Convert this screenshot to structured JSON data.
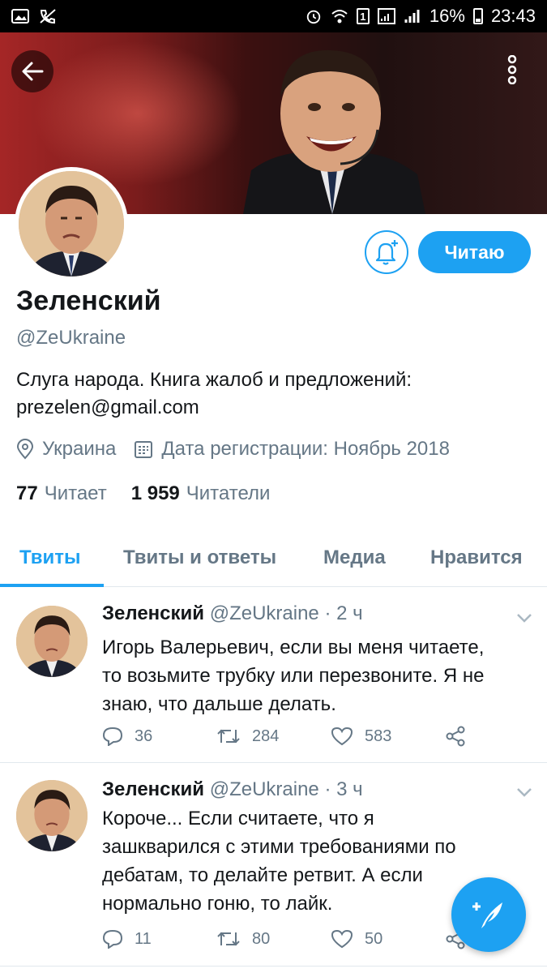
{
  "status_bar": {
    "sim_label": "1",
    "battery_percent": "16%",
    "time": "23:43"
  },
  "profile": {
    "name": "Зеленский",
    "handle": "@ZeUkraine",
    "bio_line1": "Слуга народа. Книга жалоб и предложений:",
    "bio_line2": "prezelen@gmail.com",
    "location": "Украина",
    "joined": "Дата регистрации: Ноябрь 2018",
    "following_count": "77",
    "following_label": "Читает",
    "followers_count": "1 959",
    "followers_label": "Читатели",
    "follow_button": "Читаю"
  },
  "tabs": [
    {
      "label": "Твиты",
      "active": true
    },
    {
      "label": "Твиты и ответы",
      "active": false
    },
    {
      "label": "Медиа",
      "active": false
    },
    {
      "label": "Нравится",
      "active": false
    }
  ],
  "tweets": [
    {
      "name": "Зеленский",
      "handle_time": "@ZeUkraine · 2 ч",
      "lines": [
        "Игорь Валерьевич, если вы меня читаете,",
        "то возьмите трубку или перезвоните. Я не",
        "знаю, что дальше делать."
      ],
      "replies": "36",
      "retweets": "284",
      "likes": "583"
    },
    {
      "name": "Зеленский",
      "handle_time": "@ZeUkraine · 3 ч",
      "lines": [
        "Короче... Если считаете, что я",
        "зашкварился с этими требованиями по",
        "дебатам, то делайте ретвит. А если",
        "нормально гоню, то лайк."
      ],
      "replies": "11",
      "retweets": "80",
      "likes": "50"
    }
  ],
  "colors": {
    "accent": "#1da1f2",
    "secondary_text": "#657786",
    "primary_text": "#14171a"
  }
}
